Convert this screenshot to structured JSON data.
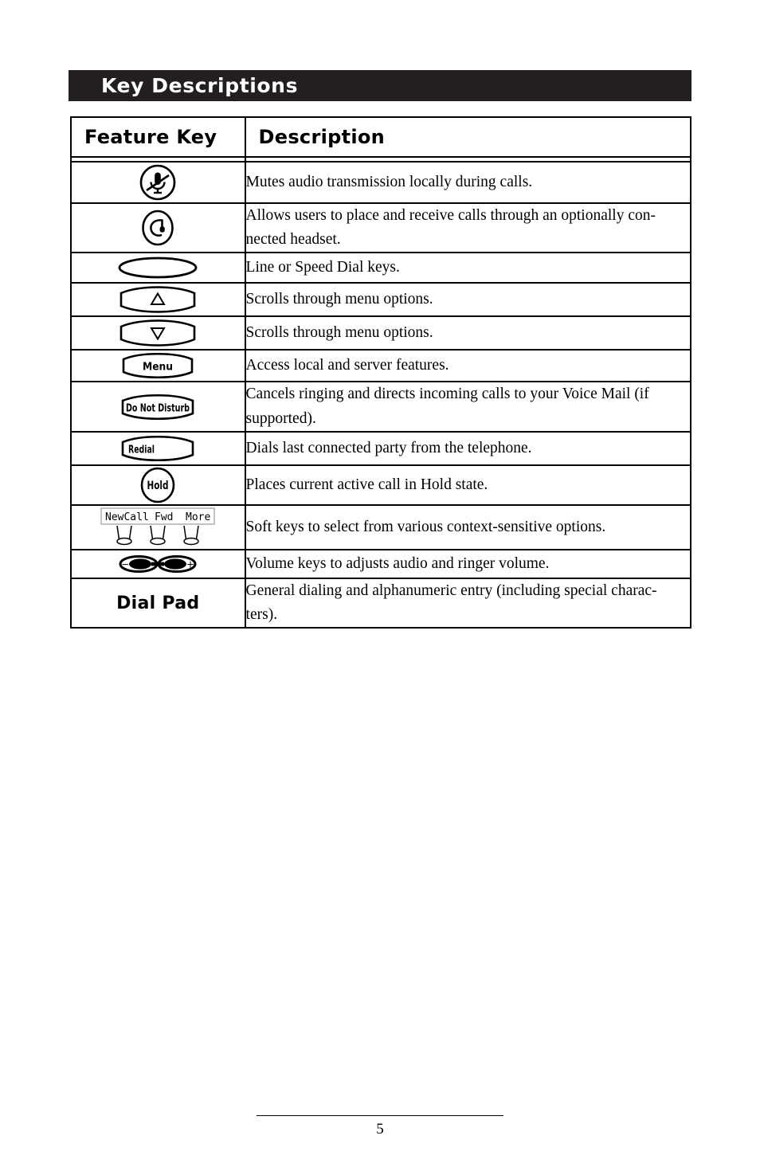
{
  "section": {
    "title": "Key Descriptions"
  },
  "table": {
    "headers": {
      "feature_key": "Feature Key",
      "description": "Description"
    },
    "rows": [
      {
        "key_icon": "mute-microphone-icon",
        "key_label": "",
        "description_lines": [
          "Mutes audio transmission locally during calls."
        ]
      },
      {
        "key_icon": "headset-icon",
        "key_label": "",
        "description_lines": [
          "Allows users to place and receive calls through an optionally con-",
          "nected headset."
        ]
      },
      {
        "key_icon": "line-key-oval-icon",
        "key_label": "",
        "description_lines": [
          "Line or Speed Dial keys."
        ]
      },
      {
        "key_icon": "scroll-up-key-icon",
        "key_label": "",
        "description_lines": [
          "Scrolls through menu options."
        ]
      },
      {
        "key_icon": "scroll-down-key-icon",
        "key_label": "",
        "description_lines": [
          "Scrolls through menu options."
        ]
      },
      {
        "key_icon": "menu-key-icon",
        "key_label": "Menu",
        "description_lines": [
          "Access local and server features."
        ]
      },
      {
        "key_icon": "do-not-disturb-key-icon",
        "key_label": "Do Not Disturb",
        "description_lines": [
          "Cancels ringing and directs incoming calls to your Voice Mail (if",
          "supported)."
        ]
      },
      {
        "key_icon": "redial-key-icon",
        "key_label": "Redial",
        "description_lines": [
          "Dials last connected party from the telephone."
        ]
      },
      {
        "key_icon": "hold-key-icon",
        "key_label": "Hold",
        "description_lines": [
          "Places current active call in Hold state."
        ]
      },
      {
        "key_icon": "soft-keys-icon",
        "key_label": "",
        "soft_key_labels": [
          "NewCall",
          "Fwd",
          "More"
        ],
        "description_lines": [
          "Soft keys to select from various context-sensitive options."
        ]
      },
      {
        "key_icon": "volume-keys-icon",
        "key_label": "",
        "volume_minus": "−",
        "volume_plus": "+",
        "description_lines": [
          "Volume keys to adjusts audio and ringer volume."
        ]
      },
      {
        "key_icon": "",
        "key_label": "Dial Pad",
        "description_lines": [
          "General dialing and alphanumeric entry (including special charac-",
          "ters)."
        ]
      }
    ]
  },
  "footer": {
    "page_number": "5"
  },
  "colors": {
    "header_bar": "#231f20",
    "header_text": "#ffffff",
    "ink": "#000000",
    "paper": "#ffffff"
  }
}
